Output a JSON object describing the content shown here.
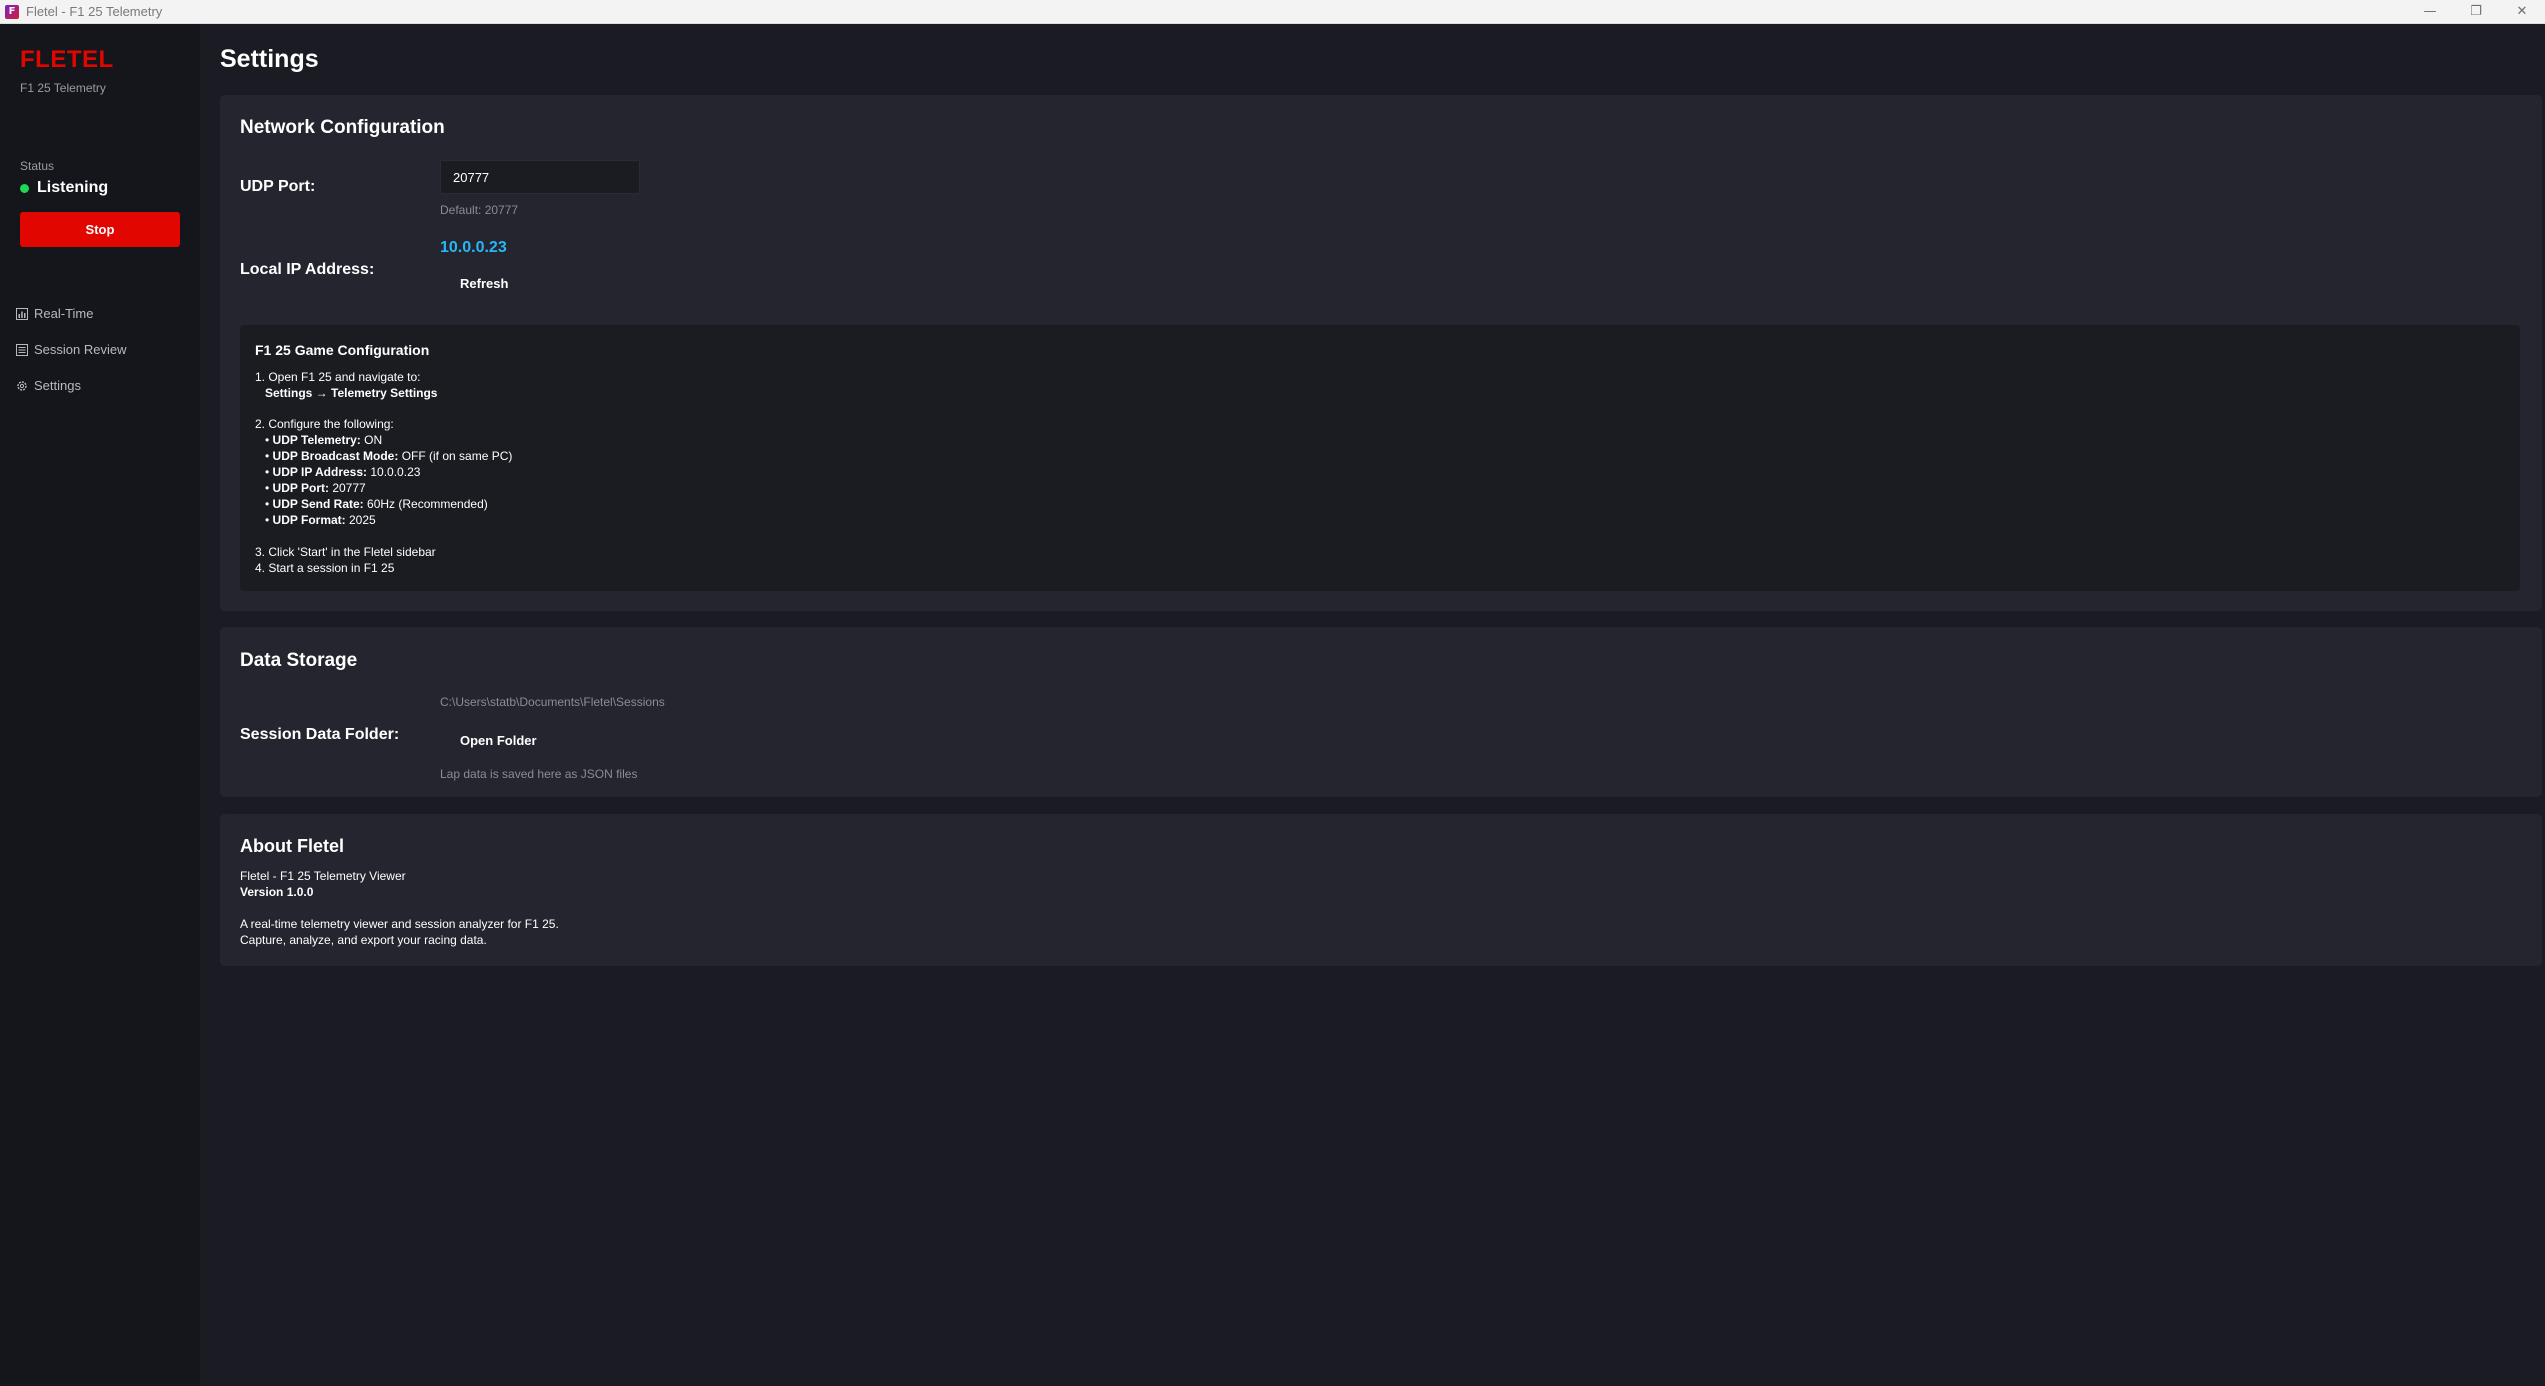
{
  "window": {
    "title": "Fletel - F1 25 Telemetry",
    "app_icon_glyph": "F",
    "controls": {
      "minimize": "—",
      "maximize": "❐",
      "close": "✕"
    }
  },
  "sidebar": {
    "brand": "FLETEL",
    "subtitle": "F1 25 Telemetry",
    "status_label": "Status",
    "status_value": "Listening",
    "status_color": "#1fd655",
    "stop_label": "Stop",
    "nav": [
      {
        "label": "Real-Time",
        "icon": "chart-icon"
      },
      {
        "label": "Session Review",
        "icon": "list-icon"
      },
      {
        "label": "Settings",
        "icon": "gear-icon"
      }
    ]
  },
  "page": {
    "title": "Settings"
  },
  "network": {
    "title": "Network Configuration",
    "udp_port_label": "UDP Port:",
    "udp_port_value": "20777",
    "udp_port_hint": "Default: 20777",
    "local_ip_label": "Local IP Address:",
    "local_ip_value": "10.0.0.23",
    "refresh_label": "Refresh",
    "game_config": {
      "title": "F1 25 Game Configuration",
      "step1": "1. Open F1 25 and navigate to:",
      "step1_path": "Settings → Telemetry Settings",
      "step2": "2. Configure the following:",
      "items": [
        {
          "key": "UDP Telemetry:",
          "value": " ON"
        },
        {
          "key": "UDP Broadcast Mode:",
          "value": " OFF (if on same PC)"
        },
        {
          "key": "UDP IP Address:",
          "value": " 10.0.0.23"
        },
        {
          "key": "UDP Port:",
          "value": " 20777"
        },
        {
          "key": "UDP Send Rate:",
          "value": " 60Hz (Recommended)"
        },
        {
          "key": "UDP Format:",
          "value": " 2025"
        }
      ],
      "bullet": "•",
      "step3": "3. Click 'Start' in the Fletel sidebar",
      "step4": "4. Start a session in F1 25"
    }
  },
  "storage": {
    "title": "Data Storage",
    "folder_label": "Session Data Folder:",
    "folder_path": "C:\\Users\\statb\\Documents\\Fletel\\Sessions",
    "open_folder_label": "Open Folder",
    "hint": "Lap data is saved here as JSON files"
  },
  "about": {
    "title": "About Fletel",
    "line1": "Fletel - F1 25 Telemetry Viewer",
    "version": "Version 1.0.0",
    "desc1": "A real-time telemetry viewer and session analyzer for F1 25.",
    "desc2": "Capture, analyze, and export your racing data."
  },
  "colors": {
    "accent_red": "#e10600",
    "ip_blue": "#29b6f6",
    "background": "#1b1c23",
    "card": "#24252f",
    "sidebar": "#15161c"
  }
}
